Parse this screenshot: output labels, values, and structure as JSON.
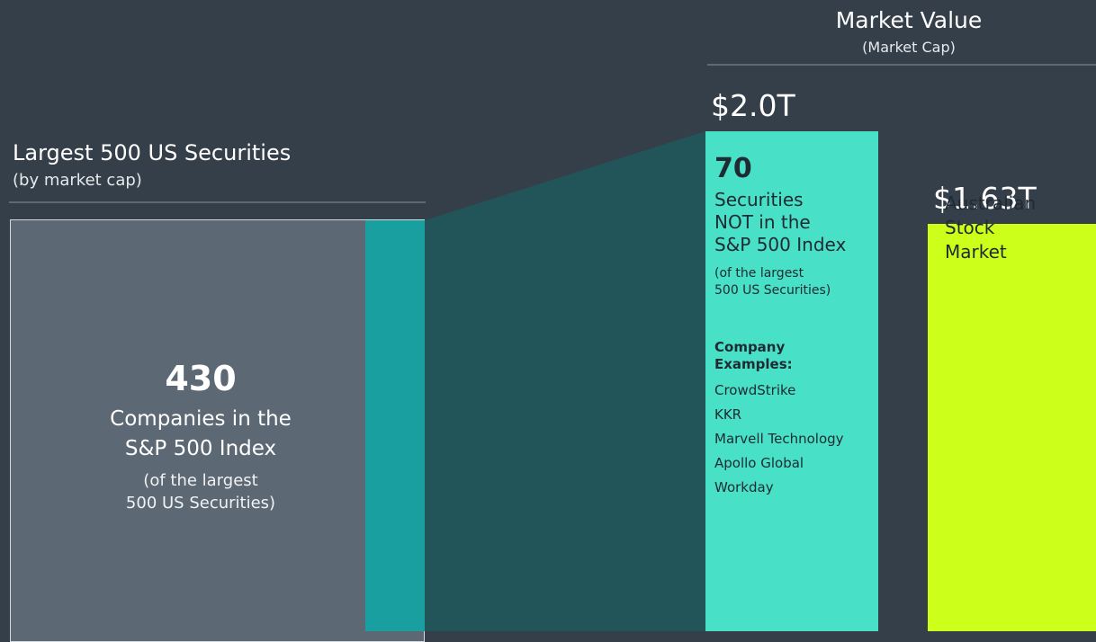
{
  "left": {
    "title": "Largest 500 US Securities",
    "subtitle": "(by market cap)",
    "count": "430",
    "desc_lines": [
      "Companies in the",
      "S&P 500 Index"
    ],
    "note_lines": [
      "(of the largest",
      "500 US Securities)"
    ]
  },
  "right": {
    "title": "Market Value",
    "subtitle": "(Market Cap)"
  },
  "bar0": {
    "count": "70",
    "desc_lines": [
      "Securities",
      "NOT in the",
      "S&P 500 Index"
    ],
    "note_lines": [
      "(of the largest",
      "500 US Securities)"
    ],
    "examples_heading_lines": [
      "Company",
      "Examples:"
    ],
    "examples": [
      "CrowdStrike",
      "KKR",
      "Marvell Technology",
      "Apollo Global",
      "Workday"
    ]
  },
  "bar1": {
    "label_lines": [
      "Australian",
      "Stock",
      "Market"
    ]
  },
  "colors": {
    "background": "#353f49",
    "sp500_block": "#5c6873",
    "non_sp500_small": "#1a9fa0",
    "connector": "#22555a",
    "non_sp500_bar": "#48e0c6",
    "australia_bar": "#ccff1a"
  },
  "chart_data": {
    "type": "bar",
    "title": "Market Value",
    "subtitle": "(Market Cap)",
    "categories": [
      "Securities NOT in the S&P 500 Index",
      "Australian Stock Market"
    ],
    "values": [
      2.0,
      1.63
    ],
    "value_labels": [
      "$2.0T",
      "$1.63T"
    ],
    "unit": "trillion USD",
    "composition": {
      "title": "Largest 500 US Securities",
      "parts": [
        {
          "label": "Companies in the S&P 500 Index",
          "count": 430
        },
        {
          "label": "Securities NOT in the S&P 500 Index",
          "count": 70
        }
      ]
    }
  }
}
